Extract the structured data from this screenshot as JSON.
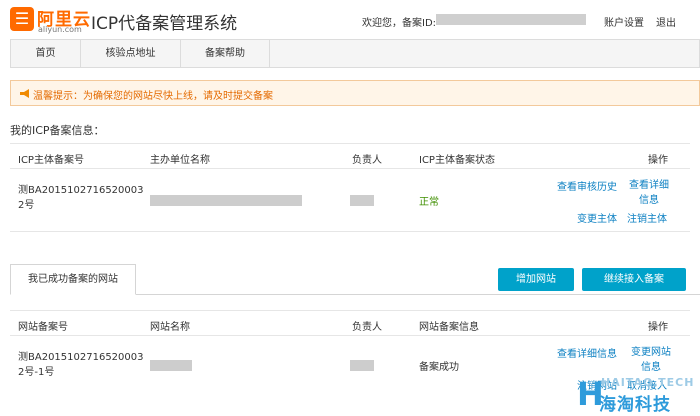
{
  "header": {
    "logo_cn": "阿里云",
    "logo_en": "aliyun.com",
    "title": "ICP代备案管理系统",
    "welcome": "欢迎您，备案ID:",
    "account_settings": "账户设置",
    "logout": "退出"
  },
  "nav": {
    "items": [
      {
        "label": "首页"
      },
      {
        "label": "核验点地址"
      },
      {
        "label": "备案帮助"
      }
    ]
  },
  "notice": {
    "text": "温馨提示：为确保您的网站尽快上线，请及时提交备案"
  },
  "icp_info": {
    "title": "我的ICP备案信息：",
    "columns": [
      "ICP主体备案号",
      "主办单位名称",
      "负责人",
      "ICP主体备案状态",
      "操作"
    ],
    "row": {
      "record_no": "测BA20151027165200032号",
      "status": "正常",
      "actions": [
        "查看审核历史",
        "查看详细信息",
        "变更主体",
        "注销主体"
      ]
    }
  },
  "sites": {
    "tab_label": "我已成功备案的网站",
    "add_site": "增加网站",
    "continue_access": "继续接入备案",
    "columns": [
      "网站备案号",
      "网站名称",
      "负责人",
      "网站备案信息",
      "操作"
    ],
    "row": {
      "record_no": "测BA20151027165200032号-1号",
      "info": "备案成功",
      "actions": [
        "查看详细信息",
        "变更网站信息",
        "注销网站",
        "取消接入"
      ]
    }
  },
  "watermark": {
    "letter": "H",
    "top": "HAITAO TECH",
    "bottom": "海淘科技"
  },
  "colors": {
    "brand": "#ff6a00",
    "link": "#0a7fc2",
    "button": "#00a2ca",
    "status_ok": "#3f8f00",
    "notice_text": "#e46a00"
  }
}
